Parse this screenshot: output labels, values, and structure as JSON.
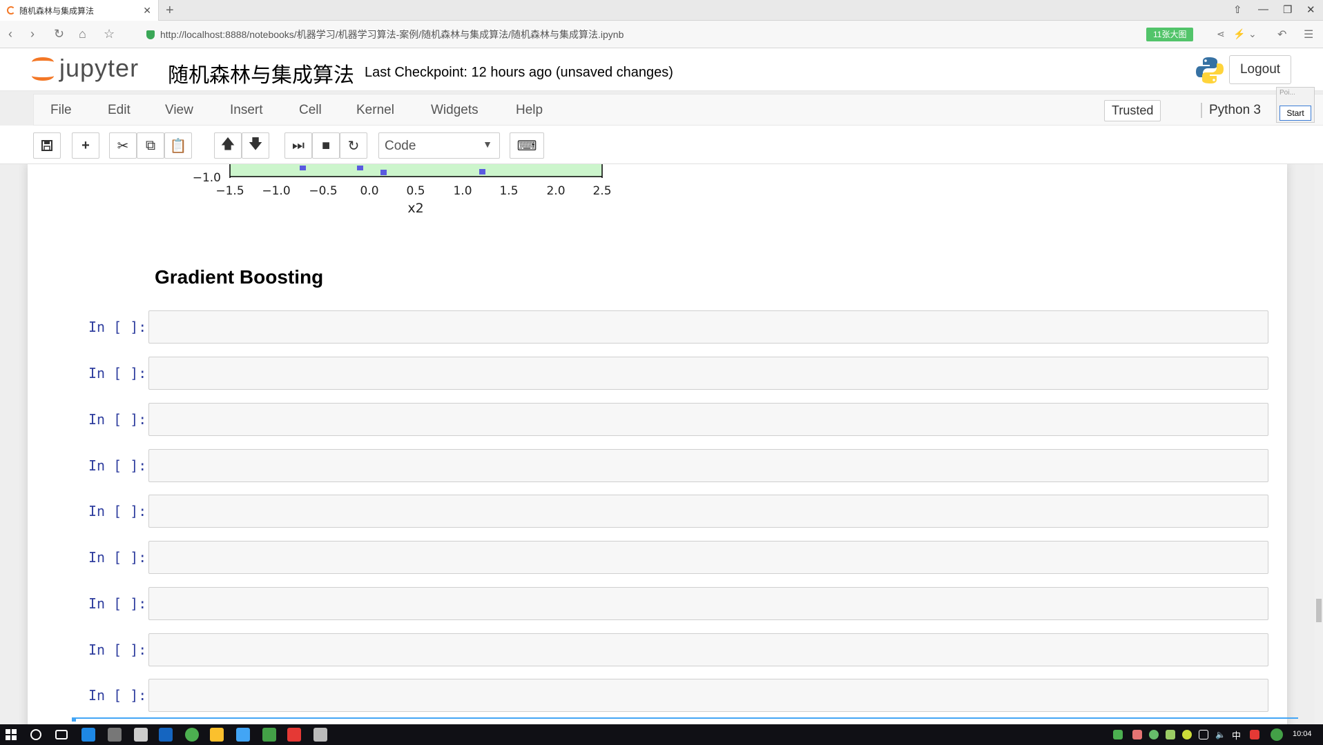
{
  "browser": {
    "tab_title": "随机森林与集成算法",
    "url": "http://localhost:8888/notebooks/机器学习/机器学习算法-案例/随机森林与集成算法/随机森林与集成算法.ipynb",
    "ext_badge": "11张大图"
  },
  "header": {
    "logo_text": "jupyter",
    "notebook_title": "随机森林与集成算法",
    "checkpoint": "Last Checkpoint: 12 hours ago (unsaved changes)",
    "logout_label": "Logout"
  },
  "menubar": {
    "items": [
      "File",
      "Edit",
      "View",
      "Insert",
      "Cell",
      "Kernel",
      "Widgets",
      "Help"
    ],
    "trusted_label": "Trusted",
    "kernel_label": "Python 3"
  },
  "popup": {
    "title": "Poi...",
    "start_label": "Start"
  },
  "toolbar": {
    "cell_type": "Code"
  },
  "plot": {
    "y_tick": "−1.0",
    "x_ticks": [
      "−1.5",
      "−1.0",
      "−0.5",
      "0.0",
      "0.5",
      "1.0",
      "1.5",
      "2.0",
      "2.5"
    ],
    "xlabel": "x2"
  },
  "notebook": {
    "heading": "Gradient Boosting",
    "empty_cells": [
      {
        "prompt": "In [ ]:"
      },
      {
        "prompt": "In [ ]:"
      },
      {
        "prompt": "In [ ]:"
      },
      {
        "prompt": "In [ ]:"
      },
      {
        "prompt": "In [ ]:"
      },
      {
        "prompt": "In [ ]:"
      },
      {
        "prompt": "In [ ]:"
      },
      {
        "prompt": "In [ ]:"
      },
      {
        "prompt": "In [ ]:"
      }
    ]
  },
  "taskbar": {
    "time": "10:04"
  }
}
